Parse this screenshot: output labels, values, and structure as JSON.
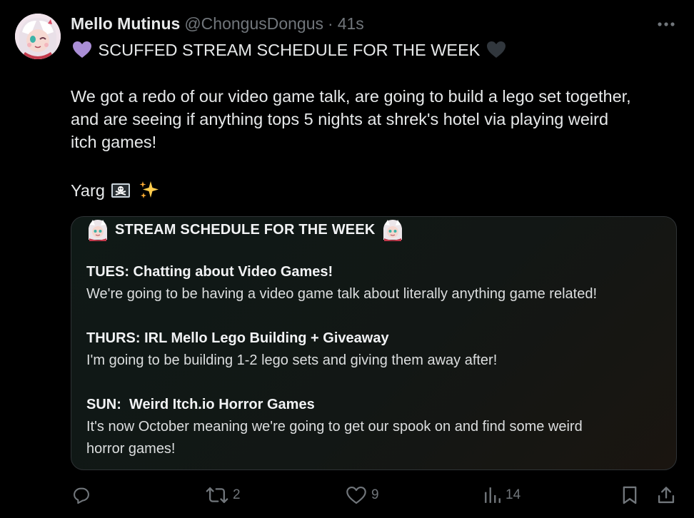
{
  "tweet": {
    "display_name": "Mello Mutinus",
    "handle": "@ChongusDongus",
    "separator": "·",
    "time": "41s",
    "headline": "SCUFFED STREAM SCHEDULE FOR THE WEEK",
    "headline_left_emoji": "purple-heart-icon",
    "headline_right_emoji": "black-heart-icon",
    "body_lines": [
      "We got a redo of our video game talk, are going to build a lego set together,",
      "and are seeing if anything tops 5 nights at shrek's hotel via playing weird",
      "itch games!"
    ],
    "sign_off": "Yarg",
    "sign_off_emojis": [
      "pirate-flag-icon",
      "sparkles-icon"
    ]
  },
  "card": {
    "title": "STREAM SCHEDULE FOR THE WEEK",
    "entries": [
      {
        "heading": "TUES: Chatting about Video Games!",
        "lines": [
          "We're going to be having a video game talk about literally anything game related!"
        ]
      },
      {
        "heading": "THURS: IRL Mello Lego Building + Giveaway",
        "lines": [
          "I'm going to be building 1-2 lego sets and giving them away after!"
        ]
      },
      {
        "heading": "SUN:  Weird Itch.io Horror Games",
        "lines": [
          "It's now October meaning we're going to get our spook on and find some weird",
          "horror games!"
        ]
      }
    ]
  },
  "actions": {
    "reply_count": "",
    "retweet_count": "2",
    "like_count": "9",
    "views_count": "14"
  },
  "colors": {
    "background": "#000000",
    "text": "#e7e9ea",
    "muted": "#71767b",
    "border": "#2f3336"
  }
}
